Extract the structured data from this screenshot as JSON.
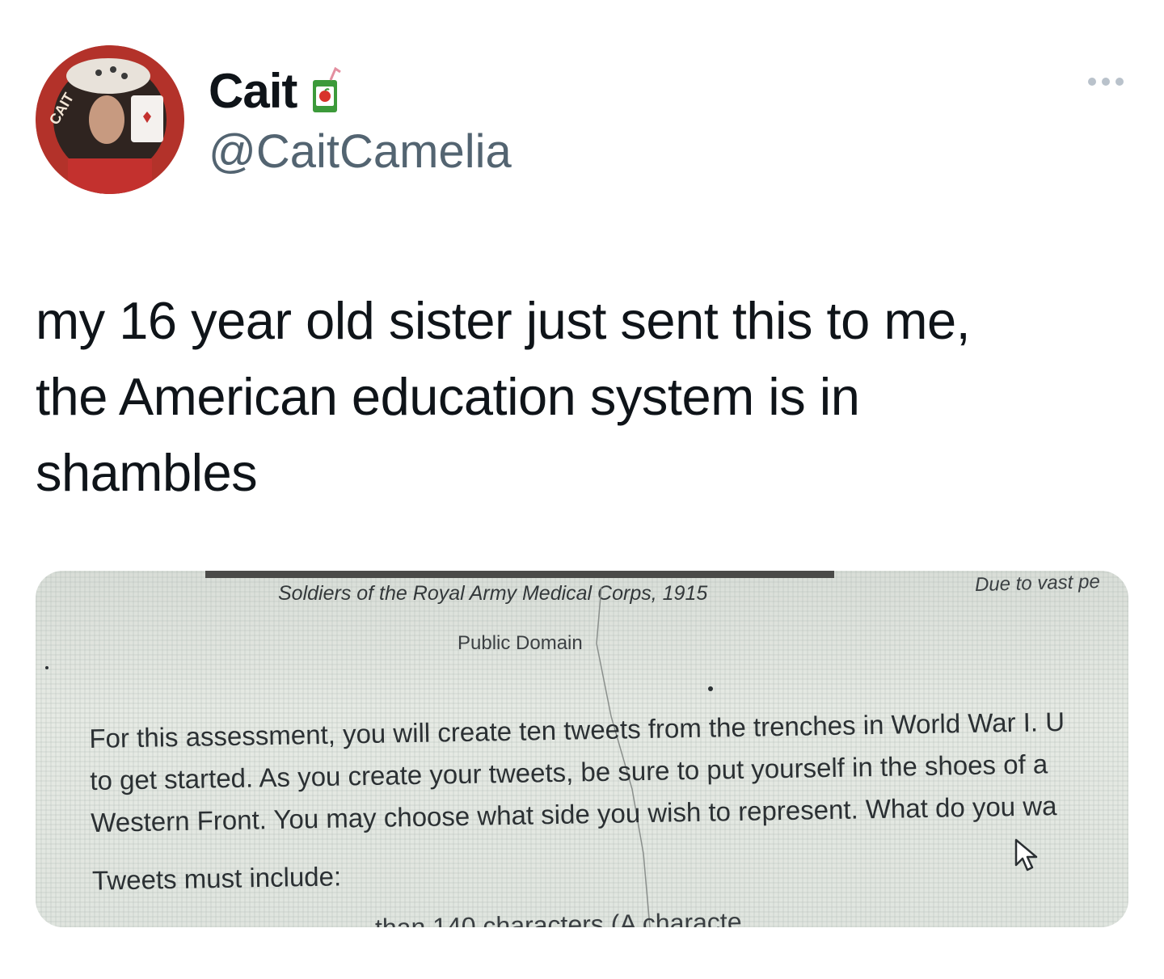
{
  "header": {
    "display_name": "Cait",
    "name_emoji_icon": "juice-box-icon",
    "handle": "@CaitCamelia",
    "more_icon": "more-options-icon"
  },
  "tweet": {
    "text_lines": [
      "my 16 year old sister just sent this to me,",
      "the American education system is in",
      "shambles"
    ]
  },
  "media": {
    "caption": "Soldiers of the Royal Army Medical Corps, 1915",
    "due_text": "Due to vast pe",
    "license": "Public Domain",
    "paragraph_lines": [
      "For this assessment, you will create ten tweets from the trenches in World War I. U",
      "to get started. As you create your tweets, be sure to put yourself in the shoes of a",
      "Western Front. You may choose what side you wish to represent. What do you wa"
    ],
    "tweets_must_include": "Tweets must include:",
    "cut_off_line": "than 140 characters (A characte"
  },
  "colors": {
    "text": "#0f1419",
    "secondary": "#536471",
    "background": "#ffffff"
  }
}
